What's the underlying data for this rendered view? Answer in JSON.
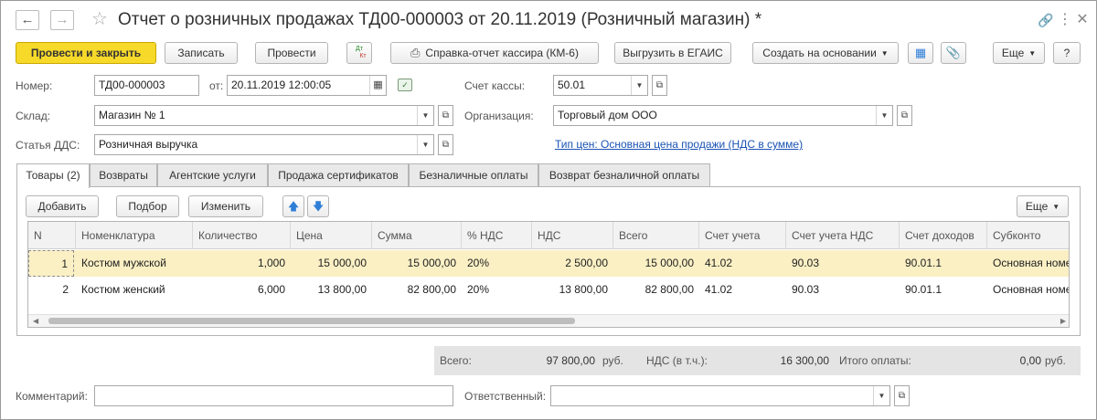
{
  "window": {
    "title": "Отчет о розничных продажах ТД00-000003 от 20.11.2019 (Розничный магазин) *"
  },
  "toolbar": {
    "post_close": "Провести и закрыть",
    "save": "Записать",
    "post": "Провести",
    "dtkt_top": "Дт",
    "dtkt_bottom": "Кт",
    "cashier_report": "Справка-отчет кассира (КМ-6)",
    "egais": "Выгрузить в ЕГАИС",
    "create_based": "Создать на основании",
    "more": "Еще",
    "help": "?"
  },
  "form": {
    "number_label": "Номер:",
    "number_value": "ТД00-000003",
    "date_label": "от:",
    "date_value": "20.11.2019 12:00:05",
    "cash_account_label": "Счет кассы:",
    "cash_account_value": "50.01",
    "warehouse_label": "Склад:",
    "warehouse_value": "Магазин № 1",
    "organization_label": "Организация:",
    "organization_value": "Торговый дом ООО",
    "dds_label": "Статья ДДС:",
    "dds_value": "Розничная выручка",
    "price_type_link": "Тип цен: Основная цена продажи (НДС в сумме)"
  },
  "tabs": [
    {
      "label": "Товары (2)",
      "active": true
    },
    {
      "label": "Возвраты",
      "active": false
    },
    {
      "label": "Агентские услуги",
      "active": false
    },
    {
      "label": "Продажа сертификатов",
      "active": false
    },
    {
      "label": "Безналичные оплаты",
      "active": false
    },
    {
      "label": "Возврат безналичной оплаты",
      "active": false
    }
  ],
  "table_toolbar": {
    "add": "Добавить",
    "pick": "Подбор",
    "change": "Изменить",
    "more": "Еще"
  },
  "table": {
    "columns": [
      "N",
      "Номенклатура",
      "Количество",
      "Цена",
      "Сумма",
      "% НДС",
      "НДС",
      "Всего",
      "Счет учета",
      "Счет учета НДС",
      "Счет доходов",
      "Субконто"
    ],
    "rows": [
      {
        "n": "1",
        "item": "Костюм мужской",
        "qty": "1,000",
        "price": "15 000,00",
        "sum": "15 000,00",
        "vat_rate": "20%",
        "vat": "2 500,00",
        "total": "15 000,00",
        "account": "41.02",
        "vat_account": "90.03",
        "income_account": "90.01.1",
        "subconto": "Основная номенклатурная группа"
      },
      {
        "n": "2",
        "item": "Костюм женский",
        "qty": "6,000",
        "price": "13 800,00",
        "sum": "82 800,00",
        "vat_rate": "20%",
        "vat": "13 800,00",
        "total": "82 800,00",
        "account": "41.02",
        "vat_account": "90.03",
        "income_account": "90.01.1",
        "subconto": "Основная номенклатурная группа"
      }
    ]
  },
  "totals": {
    "total_label": "Всего:",
    "total_value": "97 800,00",
    "currency": "руб.",
    "vat_label": "НДС (в т.ч.):",
    "vat_value": "16 300,00",
    "paid_label": "Итого оплаты:",
    "paid_value": "0,00",
    "paid_currency": "руб."
  },
  "footer": {
    "comment_label": "Комментарий:",
    "comment_value": "",
    "responsible_label": "Ответственный:",
    "responsible_value": ""
  },
  "colors": {
    "primary_button": "#f7d92a",
    "selected_row": "#fbf0c4",
    "link": "#1a52b3",
    "arrow_blue": "#2f7fd8"
  }
}
